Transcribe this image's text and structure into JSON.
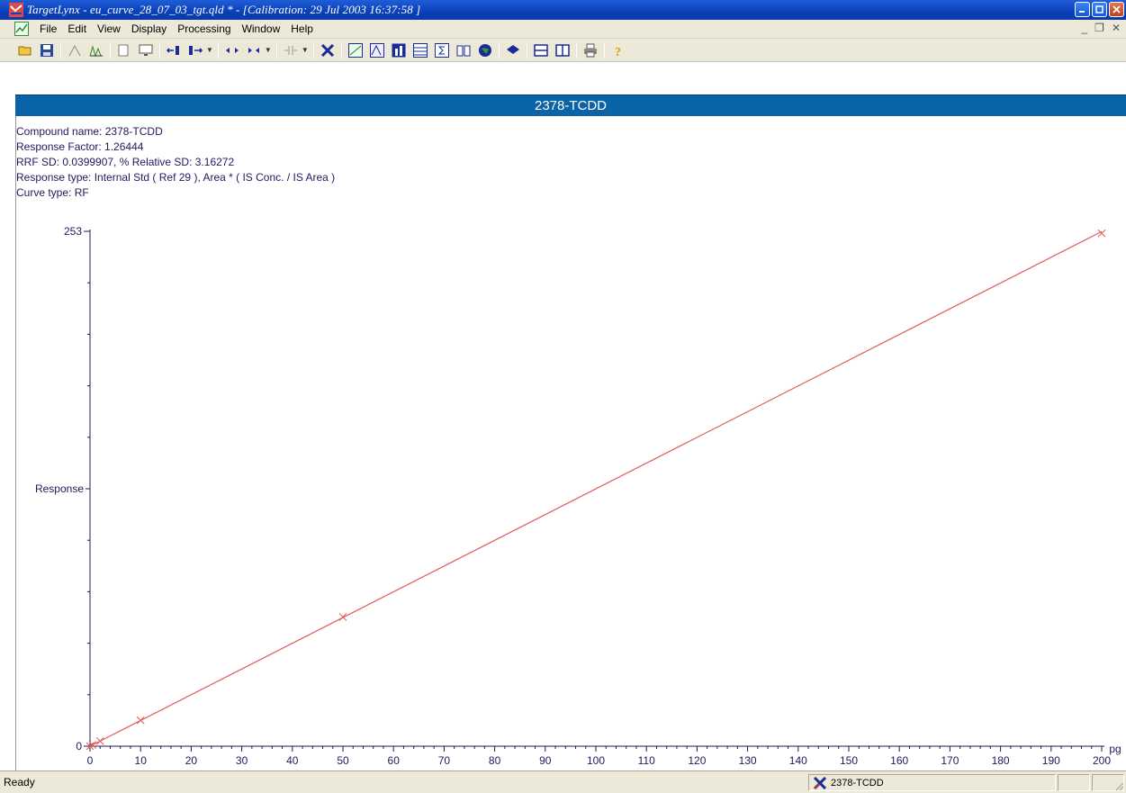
{
  "window": {
    "title": "TargetLynx - eu_curve_28_07_03_tgt.qld * - [Calibration: 29 Jul 2003 16:37:58 ]"
  },
  "menu": [
    "File",
    "Edit",
    "View",
    "Display",
    "Processing",
    "Window",
    "Help"
  ],
  "mdi_controls": [
    "_",
    "❒",
    "✕"
  ],
  "toolbar_icons": [
    "open-folder-icon",
    "save-icon",
    "curve-edit-icon",
    "peaks-icon",
    "copy-icon",
    "display-icon",
    "arrow-left-icon",
    "arrow-right-icon",
    "expand-icon",
    "shift-icon",
    "range-icon",
    "x-mark-icon",
    "calibration-icon",
    "chromatogram-icon",
    "bar-chart-icon",
    "table-icon",
    "sum-icon",
    "book-icon",
    "globe-icon",
    "layers-icon",
    "rows-icon",
    "columns-icon",
    "print-icon",
    "help-icon"
  ],
  "compound_header": "2378-TCDD",
  "info": {
    "compound_name": "Compound name: 2378-TCDD",
    "response_factor": "Response Factor: 1.26444",
    "rrf_sd": "RRF SD: 0.0399907,  % Relative SD: 3.16272",
    "response_type": "Response type: Internal Std ( Ref 29 ), Area * ( IS Conc. / IS Area )",
    "curve_type": "Curve type: RF"
  },
  "chart_data": {
    "type": "scatter",
    "xlabel": "pg",
    "ylabel": "Response",
    "xlim": [
      0,
      200
    ],
    "ylim": [
      0,
      253
    ],
    "x_ticks": [
      "0",
      "10",
      "20",
      "30",
      "40",
      "50",
      "60",
      "70",
      "80",
      "90",
      "100",
      "110",
      "120",
      "130",
      "140",
      "150",
      "160",
      "170",
      "180",
      "190",
      "200"
    ],
    "y_ticks": [
      "0",
      "253"
    ],
    "points": [
      {
        "x": 0,
        "y": 0
      },
      {
        "x": 0.5,
        "y": 0.6
      },
      {
        "x": 2,
        "y": 2.5
      },
      {
        "x": 10,
        "y": 12.7
      },
      {
        "x": 50,
        "y": 63.5
      },
      {
        "x": 200,
        "y": 252
      }
    ],
    "fit_line": {
      "x": [
        0,
        200
      ],
      "y": [
        0,
        252.9
      ]
    },
    "grid": false,
    "line_color": "#e05a5a",
    "axis_color": "#1b1b5e"
  },
  "status": {
    "text": "Ready",
    "compound": "2378-TCDD"
  }
}
